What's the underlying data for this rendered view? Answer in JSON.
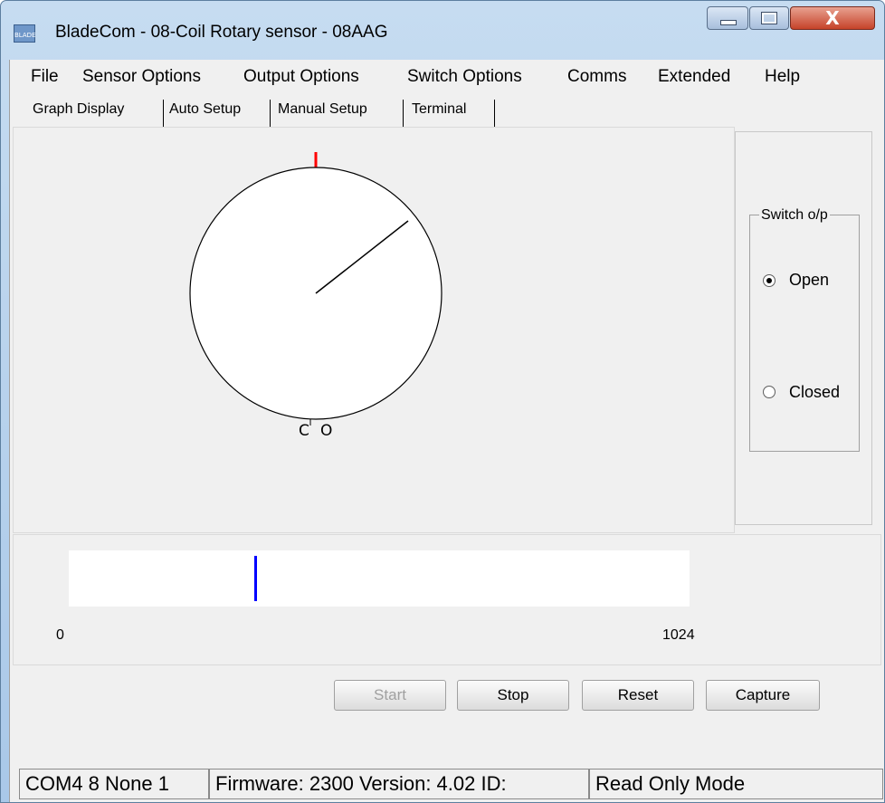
{
  "window": {
    "title": "BladeCom - 08-Coil Rotary sensor - 08AAG",
    "icon_text": "BLADE",
    "close_glyph": "X"
  },
  "menu": [
    {
      "label": "File"
    },
    {
      "label": "Sensor Options"
    },
    {
      "label": "Output Options"
    },
    {
      "label": "Switch Options"
    },
    {
      "label": "Comms"
    },
    {
      "label": "Extended"
    },
    {
      "label": "Help"
    }
  ],
  "tabs": [
    {
      "label": "Graph Display",
      "active": true
    },
    {
      "label": "Auto Setup"
    },
    {
      "label": "Manual Setup"
    },
    {
      "label": "Terminal"
    }
  ],
  "dial": {
    "label_close": "C",
    "label_open": "O",
    "marker_color": "#ff0000"
  },
  "switch_output": {
    "group_label": "Switch o/p",
    "options": [
      {
        "label": "Open",
        "selected": true
      },
      {
        "label": "Closed",
        "selected": false
      }
    ]
  },
  "bar": {
    "min_label": "0",
    "max_label": "1024",
    "marker_color": "#0000ff"
  },
  "buttons": {
    "start": "Start",
    "stop": "Stop",
    "reset": "Reset",
    "capture": "Capture"
  },
  "status": {
    "port": "COM4 8 None 1",
    "firmware": "Firmware: 2300  Version: 4.02  ID:",
    "mode": "Read Only Mode"
  }
}
